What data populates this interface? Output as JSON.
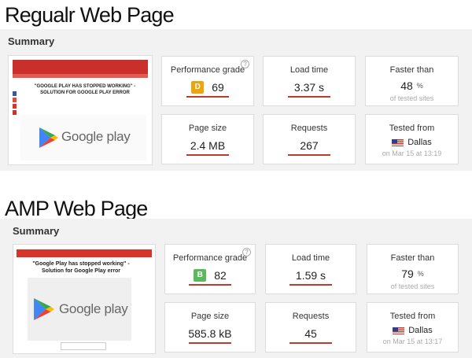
{
  "sections": [
    {
      "title": "Regualr Web Page",
      "summary_label": "Summary",
      "thumbnail": {
        "headline": "\"GOOGLE PLAY HAS STOPPED WORKING\" - SOLUTION FOR GOOGLE PLAY ERROR",
        "logo_text": "Google play"
      },
      "metrics": {
        "performance": {
          "label": "Performance grade",
          "grade": "D",
          "grade_color": "#f0a30a",
          "score": "69"
        },
        "load_time": {
          "label": "Load time",
          "value": "3.37 s"
        },
        "faster_than": {
          "label": "Faster than",
          "value": "48",
          "unit": "%",
          "sub": "of tested sites"
        },
        "page_size": {
          "label": "Page size",
          "value": "2.4 MB"
        },
        "requests": {
          "label": "Requests",
          "value": "267"
        },
        "tested_from": {
          "label": "Tested from",
          "location": "Dallas",
          "date": "on Mar 15 at 13:19"
        }
      }
    },
    {
      "title": "AMP Web Page",
      "summary_label": "Summary",
      "thumbnail": {
        "headline": "\"Google Play has stopped working\" - Solution for Google Play error",
        "logo_text": "Google play"
      },
      "metrics": {
        "performance": {
          "label": "Performance grade",
          "grade": "B",
          "grade_color": "#5cb85c",
          "score": "82"
        },
        "load_time": {
          "label": "Load time",
          "value": "1.59 s"
        },
        "faster_than": {
          "label": "Faster than",
          "value": "79",
          "unit": "%",
          "sub": "of tested sites"
        },
        "page_size": {
          "label": "Page size",
          "value": "585.8 kB"
        },
        "requests": {
          "label": "Requests",
          "value": "45"
        },
        "tested_from": {
          "label": "Tested from",
          "location": "Dallas",
          "date": "on Mar 15 at 13:17"
        }
      }
    }
  ],
  "colors": {
    "accent_red": "#c0392b",
    "panel_bg": "#f2f2f2"
  }
}
